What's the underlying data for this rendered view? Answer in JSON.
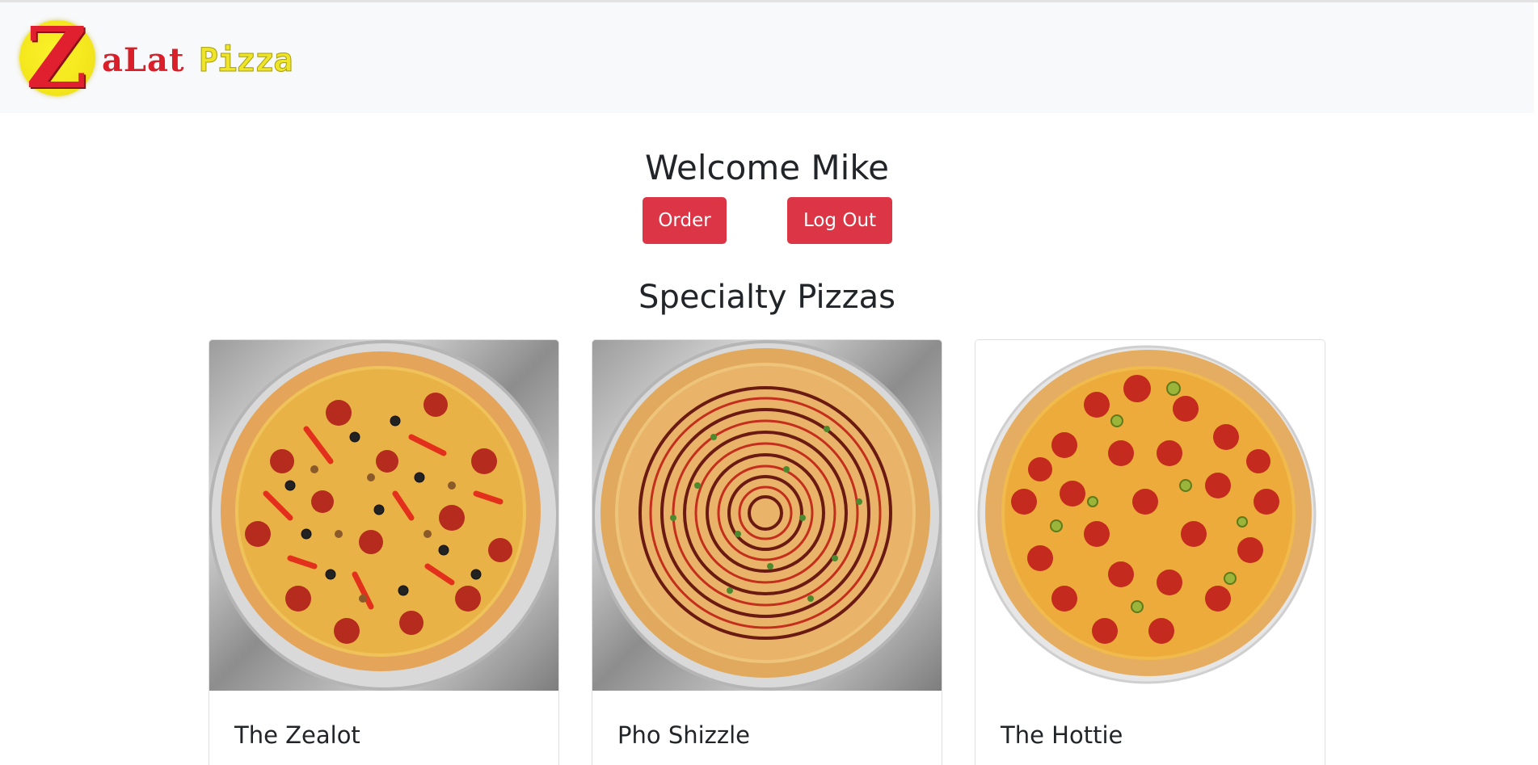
{
  "header": {
    "logo_letter": "Z",
    "logo_text_1": "aLat",
    "logo_text_2": "Pizza"
  },
  "welcome": {
    "title": "Welcome Mike"
  },
  "actions": {
    "order_label": "Order",
    "logout_label": "Log Out"
  },
  "specialty": {
    "title": "Specialty Pizzas",
    "pizzas": [
      {
        "name": "The Zealot"
      },
      {
        "name": "Pho Shizzle"
      },
      {
        "name": "The Hottie"
      }
    ]
  },
  "colors": {
    "accent_red": "#dc3545",
    "navbar_bg": "#f8f9fa",
    "logo_yellow": "#f3e51c",
    "logo_red": "#e0202e"
  }
}
